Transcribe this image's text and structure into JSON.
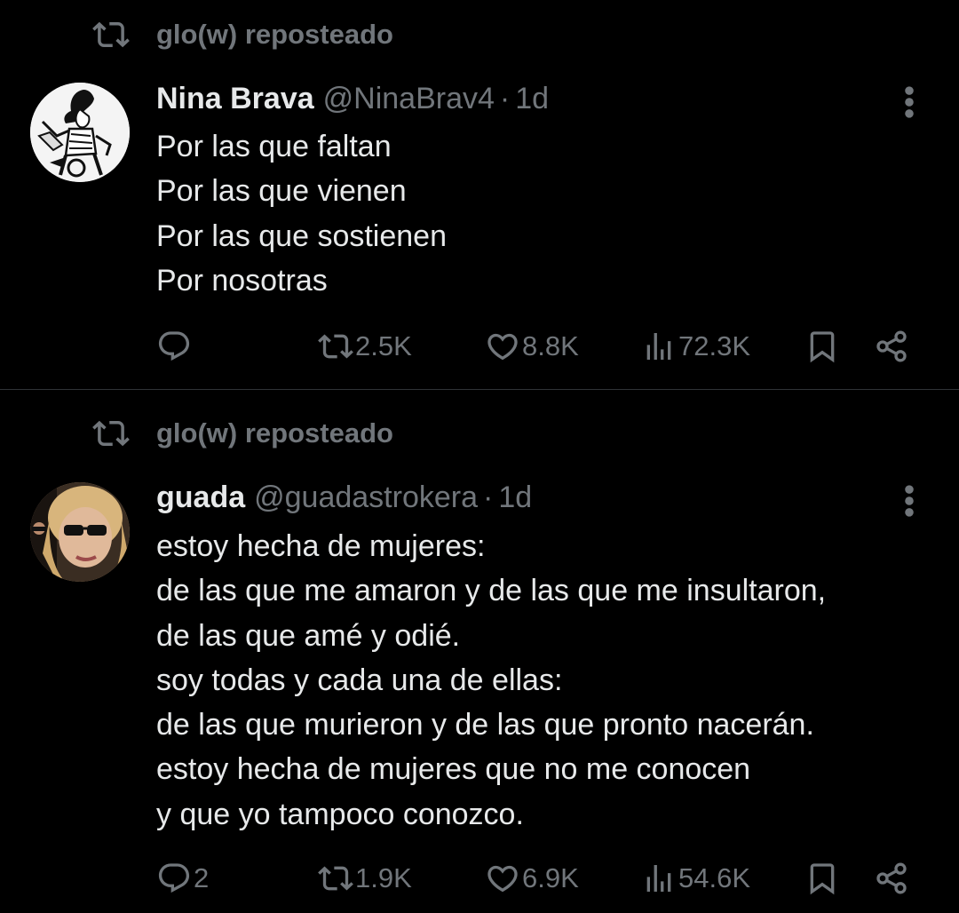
{
  "tweets": [
    {
      "repost_text": "glo(w) reposteado",
      "name": "Nina Brava",
      "handle": "@NinaBrav4",
      "separator": "·",
      "time": "1d",
      "lines": [
        "Por las que faltan",
        "Por las que vienen",
        "Por las que sostienen",
        "Por nosotras"
      ],
      "replies": "",
      "reposts": "2.5K",
      "likes": "8.8K",
      "views": "72.3K"
    },
    {
      "repost_text": "glo(w) reposteado",
      "name": "guada",
      "handle": "@guadastrokera",
      "separator": "·",
      "time": "1d",
      "lines": [
        "estoy hecha de mujeres:",
        "de las que me amaron y de las que me insultaron,",
        "de las que amé y odié.",
        "soy todas y cada una de ellas:",
        "de las que murieron y de las que pronto nacerán.",
        "estoy hecha de mujeres que no me conocen",
        "y que yo tampoco conozco."
      ],
      "replies": "2",
      "reposts": "1.9K",
      "likes": "6.9K",
      "views": "54.6K"
    }
  ],
  "icons": {
    "repost": "repost-icon",
    "reply": "reply-icon",
    "like": "heart-icon",
    "views": "views-icon",
    "bookmark": "bookmark-icon",
    "share": "share-icon",
    "more": "more-icon"
  },
  "colors": {
    "background": "#000000",
    "text": "#e7e9ea",
    "muted": "#71767b",
    "divider": "#2f3336"
  }
}
